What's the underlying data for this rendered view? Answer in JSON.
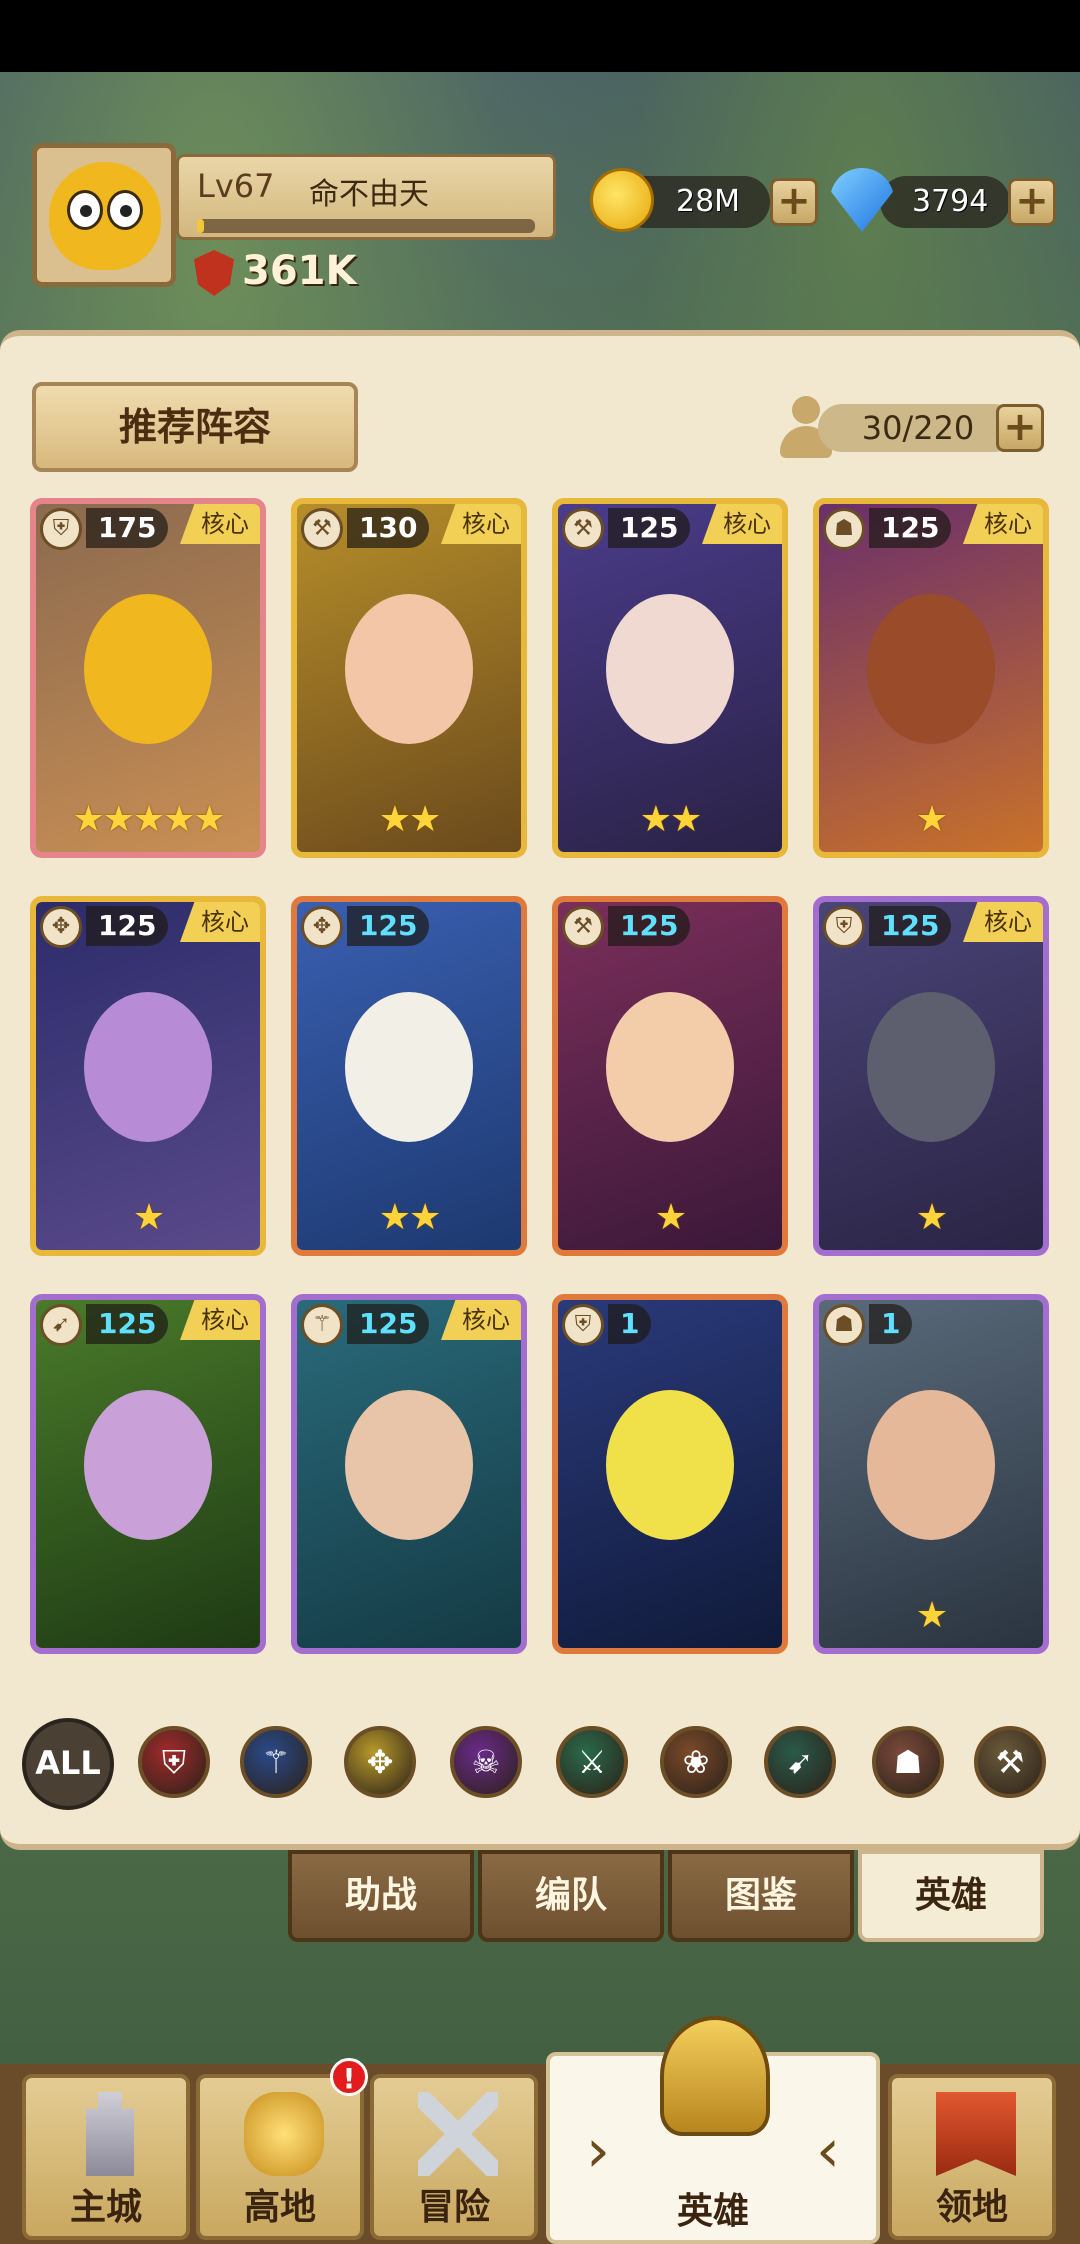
{
  "player": {
    "level": "Lv67",
    "name": "命不由天",
    "exp_fraction": 0.02,
    "power": "361K"
  },
  "resources": {
    "gold": "28M",
    "gems": "3794"
  },
  "panel": {
    "recommend_label": "推荐阵容",
    "hero_count": "30/220",
    "core_label": "核心"
  },
  "heroes": [
    {
      "level": "175",
      "stars": "★★★★★",
      "core": true,
      "frame": "pink",
      "type_icon": "shield-icon"
    },
    {
      "level": "130",
      "stars": "★★",
      "core": true,
      "frame": "gold",
      "type_icon": "axe-icon"
    },
    {
      "level": "125",
      "stars": "★★",
      "core": true,
      "frame": "gold",
      "type_icon": "axe-icon"
    },
    {
      "level": "125",
      "stars": "★",
      "core": true,
      "frame": "gold",
      "type_icon": "beast-icon"
    },
    {
      "level": "125",
      "stars": "★",
      "core": true,
      "frame": "gold",
      "type_icon": "wing-icon"
    },
    {
      "level": "125",
      "stars": "★★",
      "core": false,
      "frame": "orange",
      "type_icon": "wing-icon"
    },
    {
      "level": "125",
      "stars": "★",
      "core": false,
      "frame": "orange",
      "type_icon": "axe-icon"
    },
    {
      "level": "125",
      "stars": "★",
      "core": true,
      "frame": "purple",
      "type_icon": "shield-icon"
    },
    {
      "level": "125",
      "stars": "",
      "core": true,
      "frame": "purple",
      "type_icon": "bow-icon"
    },
    {
      "level": "125",
      "stars": "",
      "core": true,
      "frame": "purple",
      "type_icon": "staff-icon"
    },
    {
      "level": "1",
      "stars": "",
      "core": false,
      "frame": "orange",
      "type_icon": "shield-icon"
    },
    {
      "level": "1",
      "stars": "★",
      "core": false,
      "frame": "purple",
      "type_icon": "beast-icon"
    }
  ],
  "filters": {
    "all_label": "ALL",
    "items": [
      "shield-icon",
      "staff-icon",
      "wing-icon",
      "skull-icon",
      "sword-icon",
      "paw-icon",
      "bow-icon",
      "beast-icon",
      "hammer-icon"
    ]
  },
  "sub_tabs": [
    "助战",
    "编队",
    "图鉴",
    "英雄"
  ],
  "nav": [
    "主城",
    "高地",
    "冒险",
    "英雄",
    "领地"
  ],
  "notification_mark": "!",
  "colors": {
    "panel_bg": "#f2e7cf",
    "gold_frame": "#e8b83a",
    "purple_frame": "#a46ed0",
    "orange_frame": "#e07a3c",
    "pink_frame": "#e6848c"
  }
}
